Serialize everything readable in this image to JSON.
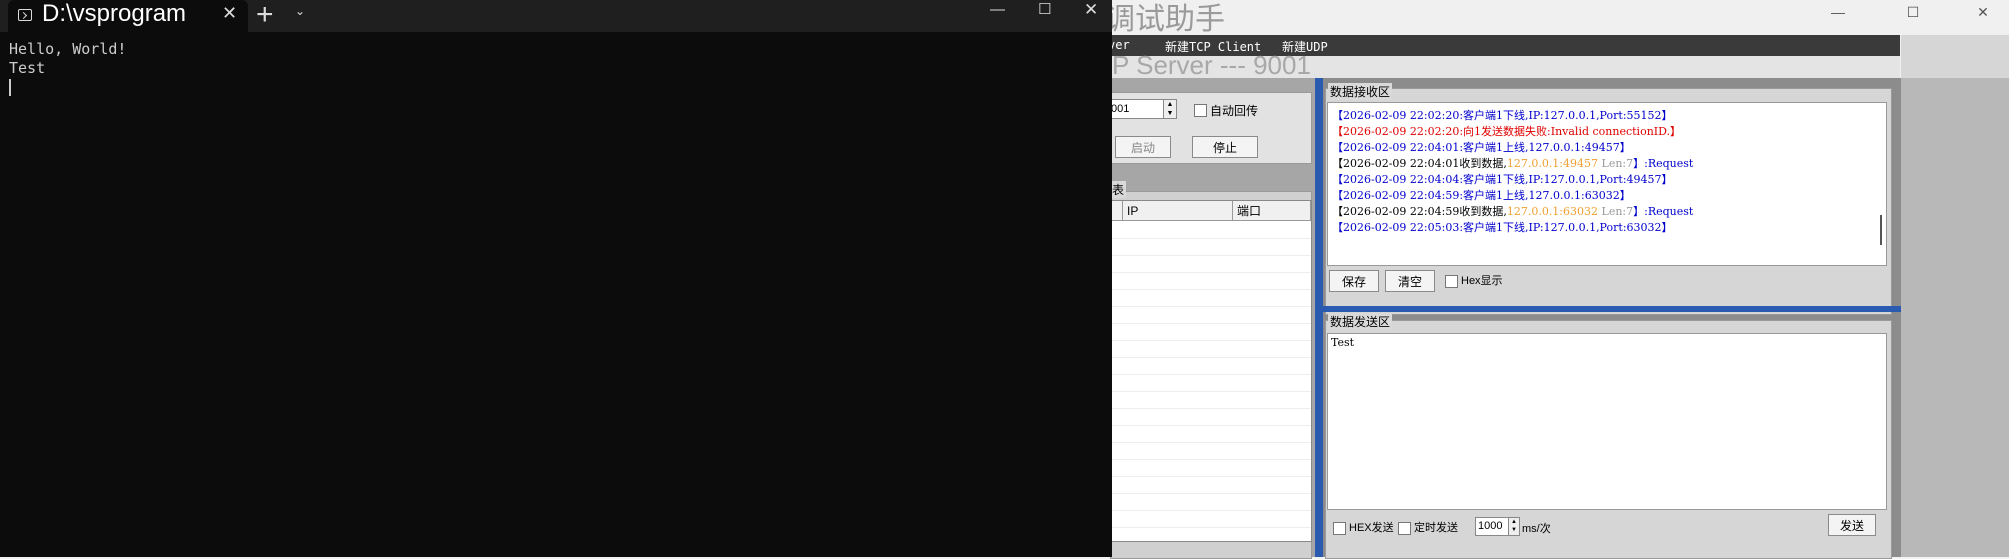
{
  "terminal": {
    "tab_title": "D:\\vsprogram",
    "close_glyph": "✕",
    "new_tab_glyph": "+",
    "dropdown_glyph": "⌄",
    "minimize_glyph": "—",
    "maximize_glyph": "☐",
    "window_close_glyph": "✕",
    "lines": [
      "Hello, World!",
      "Test"
    ]
  },
  "assistant": {
    "title": "络调试助手",
    "window_controls": {
      "minimize": "—",
      "maximize": "☐",
      "close": "✕"
    },
    "menu": {
      "item_partial": "ver",
      "tcp_client": "新建TCP Client",
      "udp": "新建UDP"
    },
    "server_title": "P Server --- 9001",
    "port_value": "001",
    "auto_reply_label": "自动回传",
    "start_button": "启动",
    "stop_button": "停止",
    "client_list_label": "表",
    "table_headers": {
      "ip": "IP",
      "port": "端口"
    },
    "recv_group_label": "数据接收区",
    "log": [
      {
        "text": "【2026-02-09 22:02:20:客户端1下线,IP:127.0.0.1,Port:55152】",
        "color": "#0000cc"
      },
      {
        "text": "【2026-02-09 22:02:20:向1发送数据失败:Invalid connectionID.】",
        "color": "#e00000"
      },
      {
        "text": "【2026-02-09 22:04:01:客户端1上线,127.0.0.1:49457】",
        "color": "#0000cc"
      },
      {
        "text": "【2026-02-09 22:04:01收到数据,",
        "color": "#000000",
        "ip": "127.0.0.1:49457",
        "len": "Len:7",
        "tail": "】:Request"
      },
      {
        "text": "【2026-02-09 22:04:04:客户端1下线,IP:127.0.0.1,Port:49457】",
        "color": "#0000cc"
      },
      {
        "text": "【2026-02-09 22:04:59:客户端1上线,127.0.0.1:63032】",
        "color": "#0000cc"
      },
      {
        "text": "【2026-02-09 22:04:59收到数据,",
        "color": "#000000",
        "ip": "127.0.0.1:63032",
        "len": "Len:7",
        "tail": "】:Request"
      },
      {
        "text": "【2026-02-09 22:05:03:客户端1下线,IP:127.0.0.1,Port:63032】",
        "color": "#0000cc"
      }
    ],
    "save_button": "保存",
    "clear_button": "清空",
    "hex_display_label": "Hex显示",
    "send_group_label": "数据发送区",
    "send_text": "Test",
    "hex_send_label": "HEX发送",
    "timed_send_label": "定时发送",
    "interval_value": "1000",
    "interval_unit": "ms/次",
    "send_button": "发送"
  }
}
